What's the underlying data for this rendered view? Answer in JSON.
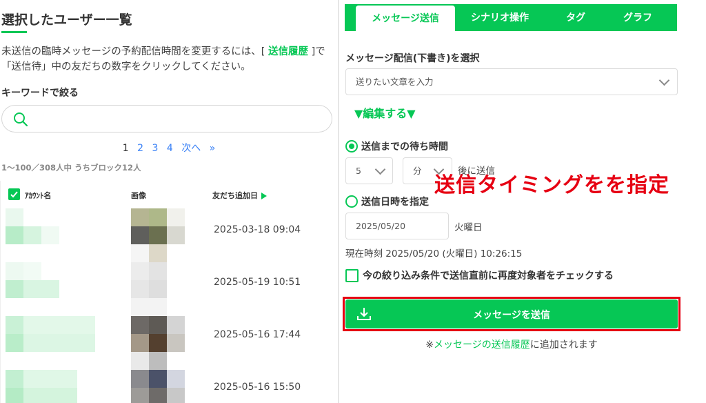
{
  "left": {
    "title": "選択したユーザー一覧",
    "desc_part1": "未送信の臨時メッセージの予約配信時間を変更するには、[ ",
    "desc_link": "送信履歴",
    "desc_part2": " ]で「送信待」中の友だちの数字をクリックしてください。",
    "keyword_label": "キーワードで絞る",
    "pager": {
      "current": "1",
      "pages": [
        "2",
        "3",
        "4"
      ],
      "next": "次へ",
      "last": "»"
    },
    "count": "1〜100／308人中 うちブロック12人",
    "columns": [
      "ｱｶｳﾝﾄ名",
      "画像",
      "友だち追加日"
    ],
    "rows": [
      {
        "date": "2025-03-18 09:04"
      },
      {
        "date": "2025-05-19 10:51"
      },
      {
        "date": "2025-05-16 17:44"
      },
      {
        "date": "2025-05-16 15:50"
      }
    ]
  },
  "right": {
    "tabs": [
      "メッセージ送信",
      "シナリオ操作",
      "タグ",
      "グラフ"
    ],
    "message_select_label": "メッセージ配信(下書き)を選択",
    "message_select_value": "送りたい文章を入力",
    "edit_label": "▼編集する▼",
    "wait_label": "送信までの待ち時間",
    "wait_num": "5",
    "wait_unit": "分",
    "wait_suffix": "後に送信",
    "datetime_label": "送信日時を指定",
    "date_value": "2025/05/20",
    "weekday": "火曜日",
    "now_text": "現在時刻 2025/05/20 (火曜日) 10:26:15",
    "recheck_label": "今の絞り込み条件で送信直前に再度対象者をチェックする",
    "send_label": "メッセージを送信",
    "note_prefix": "※",
    "note_link": "メッセージの送信履歴",
    "note_suffix": "に追加されます"
  },
  "annotation": "送信タイミングをを指定",
  "colors": {
    "accent": "#06c755",
    "annotation": "#e60012"
  }
}
